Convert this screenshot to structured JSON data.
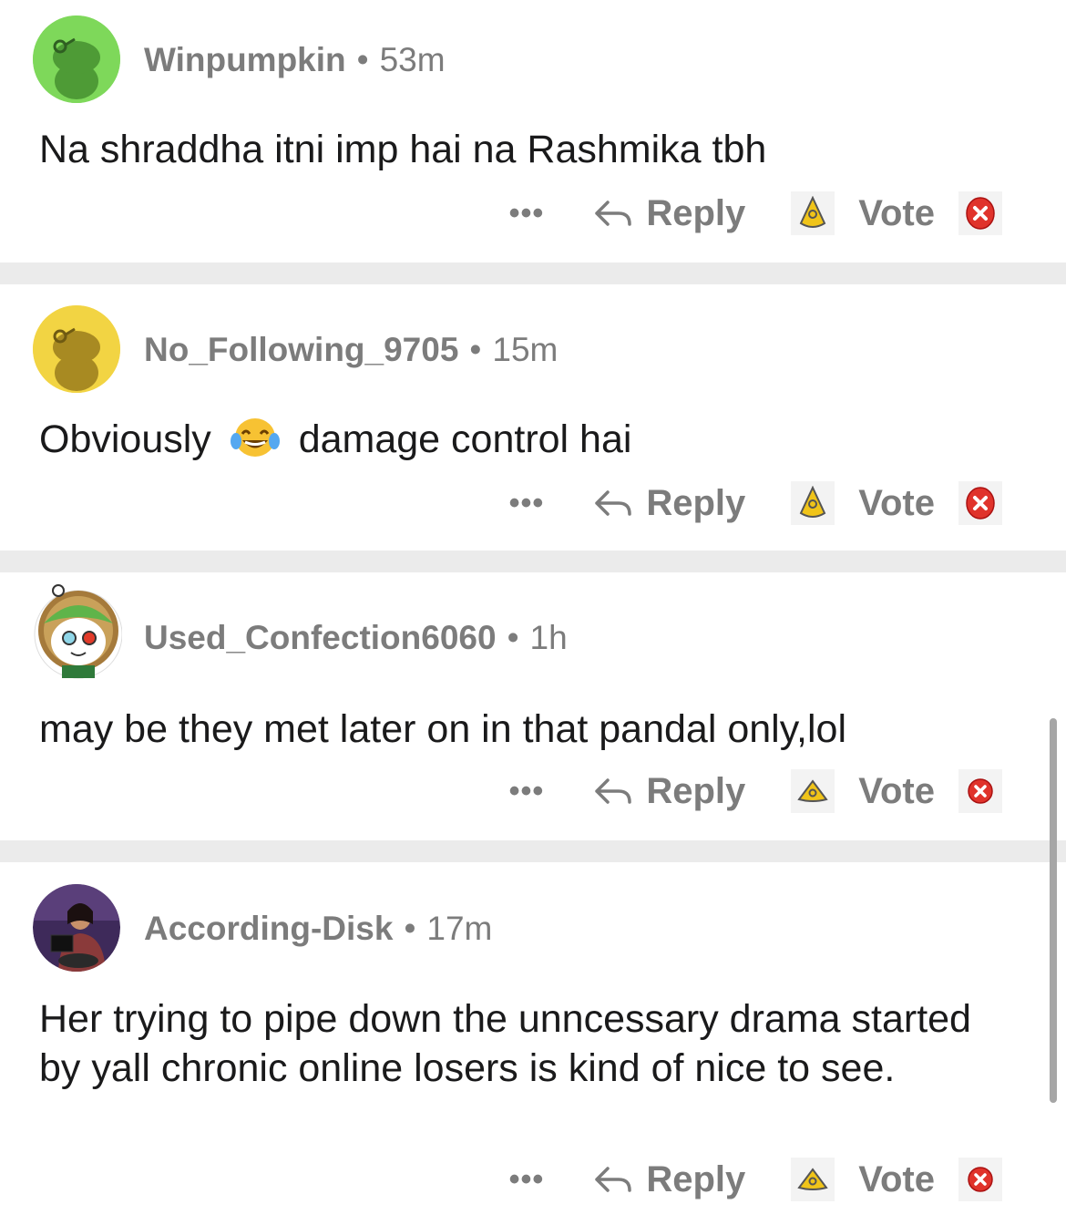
{
  "comments": [
    {
      "username": "Winpumpkin",
      "time": "53m",
      "text": "Na shraddha itni imp hai na Rashmika tbh",
      "avatar": "green-snoo-avatar"
    },
    {
      "username": "No_Following_9705",
      "time": "15m",
      "text_before": "Obviously",
      "emoji": "tears-of-joy",
      "text_after": "damage control hai",
      "avatar": "yellow-snoo-avatar"
    },
    {
      "username": "Used_Confection6060",
      "time": "1h",
      "text": "may be they met later on in that pandal only,lol",
      "avatar": "frog-hood-avatar"
    },
    {
      "username": "According-Disk",
      "time": "17m",
      "text": "Her trying to pipe down the unncessary drama started by yall chronic online losers is kind of nice to see.",
      "avatar": "photo-avatar"
    }
  ],
  "actions": {
    "more": "•••",
    "reply": "Reply",
    "vote": "Vote"
  },
  "separator": "•",
  "colors": {
    "green_avatar": "#7ed85a",
    "yellow_avatar": "#f2d443",
    "meta_gray": "#7c7c7c",
    "divider": "#ebebeb",
    "downvote_red": "#e0332b",
    "upvote_gold": "#f0c419"
  }
}
